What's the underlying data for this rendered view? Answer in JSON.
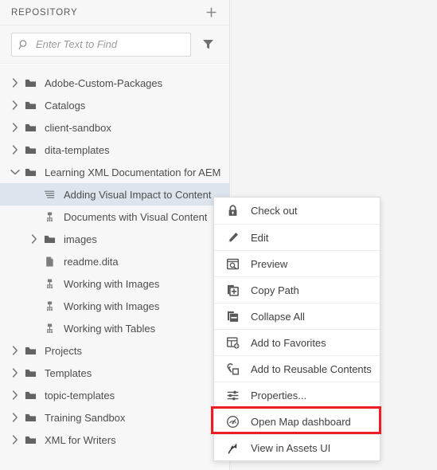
{
  "panel": {
    "title": "REPOSITORY",
    "add_icon": "plus-icon",
    "filter_icon": "filter-funnel-icon"
  },
  "search": {
    "placeholder": "Enter Text to Find",
    "value": "",
    "icon": "search-icon"
  },
  "tree": {
    "items": [
      {
        "label": "Adobe-Custom-Packages",
        "icon": "folder-icon",
        "twisty": "chevron-right-icon",
        "level": 0,
        "selected": false
      },
      {
        "label": "Catalogs",
        "icon": "folder-icon",
        "twisty": "chevron-right-icon",
        "level": 0,
        "selected": false
      },
      {
        "label": "client-sandbox",
        "icon": "folder-icon",
        "twisty": "chevron-right-icon",
        "level": 0,
        "selected": false
      },
      {
        "label": "dita-templates",
        "icon": "folder-icon",
        "twisty": "chevron-right-icon",
        "level": 0,
        "selected": false
      },
      {
        "label": "Learning XML Documentation for AEM",
        "icon": "folder-icon",
        "twisty": "chevron-down-icon",
        "level": 0,
        "selected": false
      },
      {
        "label": "Adding Visual Impact to Content",
        "icon": "ditamap-icon",
        "twisty": "none",
        "level": 1,
        "selected": true
      },
      {
        "label": "Documents with Visual Content",
        "icon": "dita-topic-icon",
        "twisty": "none",
        "level": 1,
        "selected": false
      },
      {
        "label": "images",
        "icon": "folder-icon",
        "twisty": "chevron-right-icon",
        "level": 1,
        "selected": false
      },
      {
        "label": "readme.dita",
        "icon": "file-icon",
        "twisty": "none",
        "level": 1,
        "selected": false
      },
      {
        "label": "Working with Images",
        "icon": "dita-topic-icon",
        "twisty": "none",
        "level": 1,
        "selected": false
      },
      {
        "label": "Working with Images",
        "icon": "dita-topic-icon",
        "twisty": "none",
        "level": 1,
        "selected": false
      },
      {
        "label": "Working with Tables",
        "icon": "dita-topic-icon",
        "twisty": "none",
        "level": 1,
        "selected": false
      },
      {
        "label": "Projects",
        "icon": "folder-icon",
        "twisty": "chevron-right-icon",
        "level": 0,
        "selected": false
      },
      {
        "label": "Templates",
        "icon": "folder-icon",
        "twisty": "chevron-right-icon",
        "level": 0,
        "selected": false
      },
      {
        "label": "topic-templates",
        "icon": "folder-icon",
        "twisty": "chevron-right-icon",
        "level": 0,
        "selected": false
      },
      {
        "label": "Training Sandbox",
        "icon": "folder-icon",
        "twisty": "chevron-right-icon",
        "level": 0,
        "selected": false
      },
      {
        "label": "XML for Writers",
        "icon": "folder-icon",
        "twisty": "chevron-right-icon",
        "level": 0,
        "selected": false
      }
    ]
  },
  "context_menu": {
    "items": [
      {
        "label": "Check out",
        "icon": "lock-icon"
      },
      {
        "label": "Edit",
        "icon": "pencil-icon"
      },
      {
        "label": "Preview",
        "icon": "preview-search-icon"
      },
      {
        "label": "Copy Path",
        "icon": "copy-plus-icon"
      },
      {
        "label": "Collapse All",
        "icon": "collapse-minus-icon"
      },
      {
        "label": "Add to Favorites",
        "icon": "favorites-grid-plus-icon"
      },
      {
        "label": "Add to Reusable Contents",
        "icon": "reusable-link-icon"
      },
      {
        "label": "Properties...",
        "icon": "sliders-icon"
      },
      {
        "label": "Open Map dashboard",
        "icon": "gauge-dashboard-icon"
      },
      {
        "label": "View in Assets UI",
        "icon": "pin-arrow-icon"
      }
    ],
    "highlighted_item": "Open Map dashboard"
  },
  "colors": {
    "highlight_box": "#ee1c25",
    "selection": "#dde4ed",
    "panel_bg": "#f7f7f7",
    "work_bg": "#f4f4f4",
    "menu_bg": "#ffffff"
  }
}
